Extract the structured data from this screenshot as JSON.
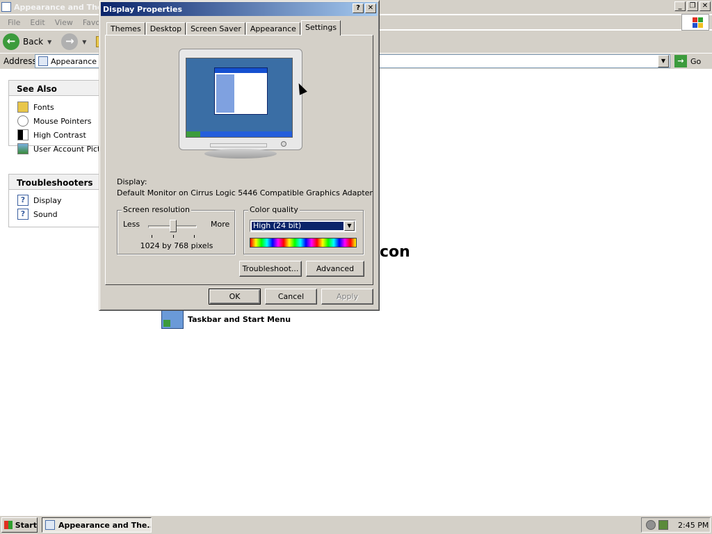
{
  "explorer": {
    "title": "Appearance and Themes",
    "menu": [
      "File",
      "Edit",
      "View",
      "Favorites"
    ],
    "toolbar": {
      "back_label": "Back"
    },
    "address": {
      "label": "Address",
      "value": "Appearance and Themes",
      "go_label": "Go"
    },
    "see_also": {
      "header": "See Also",
      "items": [
        {
          "label": "Fonts",
          "icon": "fonts-folder-icon"
        },
        {
          "label": "Mouse Pointers",
          "icon": "mouse-icon"
        },
        {
          "label": "High Contrast",
          "icon": "high-contrast-icon"
        },
        {
          "label": "User Account Pictures",
          "icon": "user-picture-icon"
        }
      ]
    },
    "troubleshooters": {
      "header": "Troubleshooters",
      "items": [
        {
          "label": "Display",
          "icon": "help-icon"
        },
        {
          "label": "Sound",
          "icon": "help-icon"
        }
      ]
    },
    "content": {
      "partial_heading": "con",
      "taskbar_item_label": "Taskbar and Start Menu"
    }
  },
  "dialog": {
    "title": "Display Properties",
    "tabs": [
      "Themes",
      "Desktop",
      "Screen Saver",
      "Appearance",
      "Settings"
    ],
    "active_tab": "Settings",
    "display_label": "Display:",
    "display_value": "Default Monitor on Cirrus Logic 5446 Compatible Graphics Adapter",
    "screen_resolution": {
      "title": "Screen resolution",
      "less_label": "Less",
      "more_label": "More",
      "value_text": "1024 by 768 pixels"
    },
    "color_quality": {
      "title": "Color quality",
      "selected": "High (24 bit)"
    },
    "buttons": {
      "troubleshoot": "Troubleshoot...",
      "advanced": "Advanced",
      "ok": "OK",
      "cancel": "Cancel",
      "apply": "Apply"
    }
  },
  "taskbar": {
    "start_label": "Start",
    "task_label": "Appearance and The...",
    "clock": "2:45 PM"
  },
  "colors": {
    "title_active_start": "#0a246a",
    "title_active_end": "#a6caf0",
    "face": "#d4d0c8",
    "desktop_preview": "#3a6ea5"
  }
}
